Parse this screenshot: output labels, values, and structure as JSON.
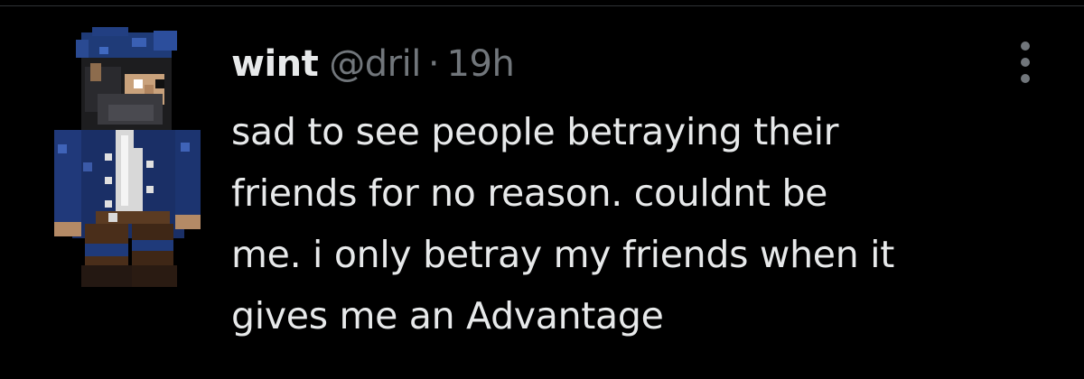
{
  "tweet": {
    "author": {
      "display_name": "wint",
      "handle": "@dril",
      "avatar_icon": "minecraft-pirate-avatar-icon"
    },
    "separator": "·",
    "time": "19h",
    "text_lines": [
      "sad to see people betraying their",
      "friends for no reason. couldnt be",
      "me. i only betray my friends when it",
      "gives me an Advantage"
    ],
    "more_icon": "more-options-icon"
  },
  "colors": {
    "background": "#000000",
    "primary_text": "#e7e9ea",
    "secondary_text": "#71767b",
    "border": "#2f3336"
  }
}
